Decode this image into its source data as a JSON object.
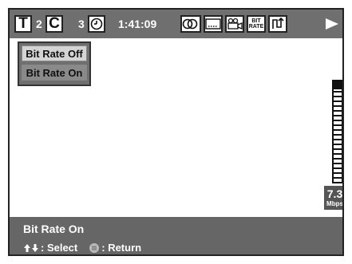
{
  "topbar": {
    "title_letter": "T",
    "title_num": "2",
    "chapter_letter": "C",
    "chapter_num": "3",
    "time": "1:41:09",
    "bit_rate_icon_line1": "BIT",
    "bit_rate_icon_line2": "RATE",
    "icons": [
      "clock-icon",
      "audio-icon",
      "subtitle-icon",
      "camera-angle-icon",
      "bit-rate-icon",
      "repeat-icon",
      "play-icon"
    ]
  },
  "menu": {
    "items": [
      {
        "label": "Bit Rate Off",
        "selected": false
      },
      {
        "label": "Bit Rate On",
        "selected": true
      }
    ]
  },
  "meter": {
    "level_fraction": 0.92,
    "value": "7.3",
    "unit": "Mbps"
  },
  "status": {
    "title": "Bit Rate On",
    "select_label": ": Select",
    "return_label": ": Return"
  },
  "colors": {
    "bar_gray": "#6f6f6f",
    "status_gray": "#666666",
    "selected_item": "#8a8a8a",
    "unselected_item": "#d4d4d4"
  }
}
